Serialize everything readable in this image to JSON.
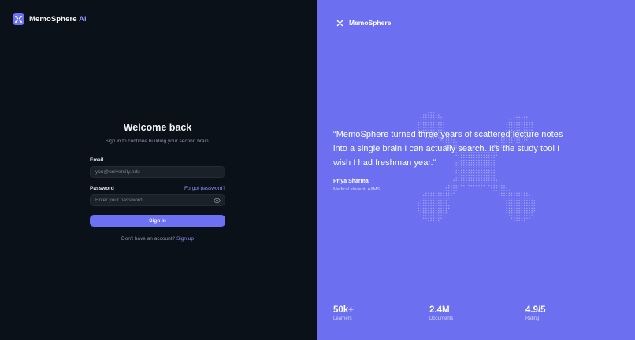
{
  "left_brand": {
    "name": "MemoSphere",
    "suffix": "AI"
  },
  "login": {
    "title": "Welcome back",
    "subtitle": "Sign in to continue building your second brain.",
    "email_label": "Email",
    "email_placeholder": "you@university.edu",
    "password_label": "Password",
    "forgot_link": "Forgot password?",
    "password_placeholder": "Enter your password",
    "sign_in_button": "Sign in",
    "signup_prompt": "Don't have an account?",
    "signup_link": "Sign up"
  },
  "right_brand": {
    "name": "MemoSphere"
  },
  "testimonial": {
    "quote": "“MemoSphere turned three years of scattered lecture notes into a single brain I can actually search. It's the study tool I wish I had freshman year.”",
    "author": "Priya Sharma",
    "role": "Medical student, AIIMS"
  },
  "stats": [
    {
      "value": "50k+",
      "label": "Learners"
    },
    {
      "value": "2.4M",
      "label": "Documents"
    },
    {
      "value": "4.9/5",
      "label": "Rating"
    }
  ],
  "colors": {
    "accent": "#6c70f2",
    "left_bg": "#0b1118",
    "right_bg": "#6b6ff0"
  },
  "icons": [
    "logo-icon",
    "eye-icon",
    "dot-pattern"
  ]
}
